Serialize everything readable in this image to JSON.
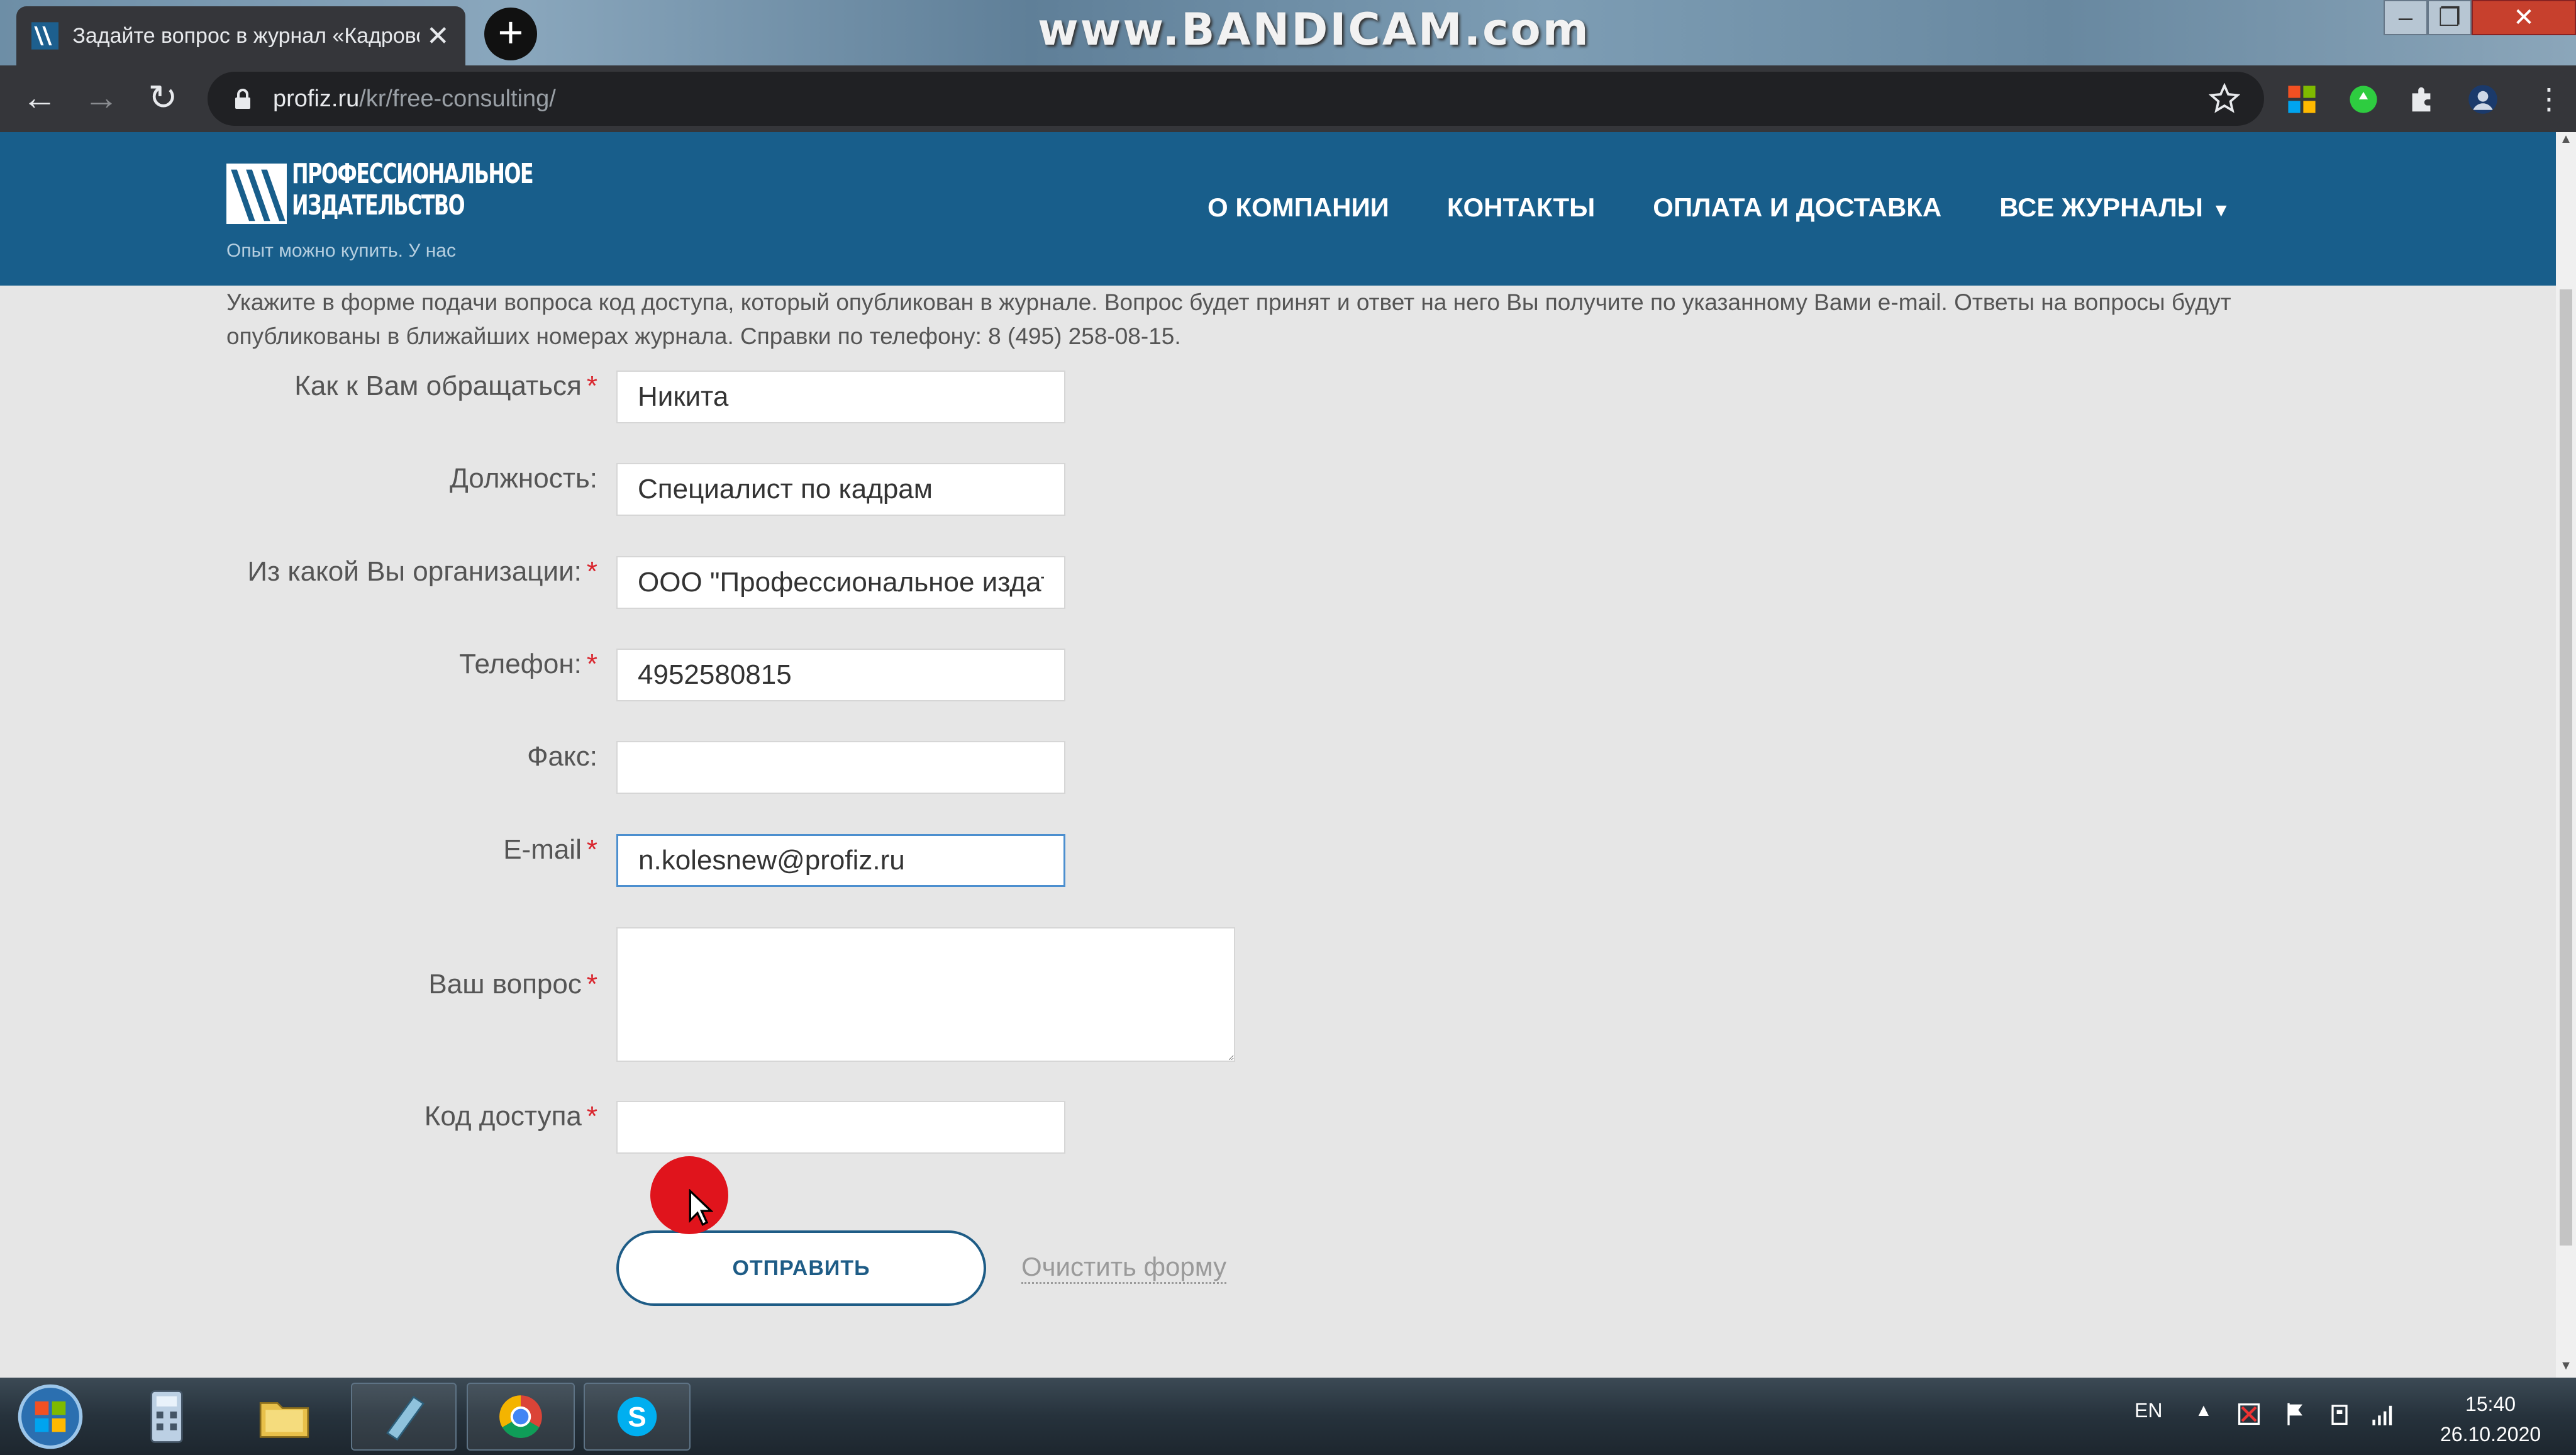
{
  "browser": {
    "tab_title": "Задайте вопрос в журнал «Кадровое дело»",
    "watermark": "www.BANDICAM.com",
    "url_host": "profiz.ru",
    "url_path": "/kr/free-consulting/"
  },
  "header": {
    "logo_line1": "ПРОФЕССИОНАЛЬНОЕ",
    "logo_line2": "ИЗДАТЕЛЬСТВО",
    "tagline": "Опыт можно купить. У нас",
    "nav": [
      "О КОМПАНИИ",
      "КОНТАКТЫ",
      "ОПЛАТА И ДОСТАВКА",
      "ВСЕ ЖУРНАЛЫ"
    ]
  },
  "intro_text": "Укажите в форме подачи вопроса код доступа, который опубликован в журнале. Вопрос будет принят и ответ на него Вы получите по указанному Вами e-mail. Ответы на вопросы будут опубликованы в ближайших номерах журнала. Справки по телефону: 8 (495) 258-08-15.",
  "form": {
    "name_label": "Как к Вам обращаться",
    "name_value": "Никита",
    "position_label": "Должность:",
    "position_value": "Специалист по кадрам",
    "org_label": "Из какой Вы организации:",
    "org_value": "ООО \"Профессиональное издательство\"",
    "phone_label": "Телефон:",
    "phone_value": "4952580815",
    "fax_label": "Факс:",
    "fax_value": "",
    "email_label": "E-mail",
    "email_value": "n.kolesnew@profiz.ru",
    "question_label": "Ваш вопрос",
    "question_value": "",
    "code_label": "Код доступа",
    "code_value": "",
    "required_mark": "*",
    "submit_label": "ОТПРАВИТЬ",
    "clear_label": "Очистить форму"
  },
  "taskbar": {
    "lang": "EN",
    "time": "15:40",
    "date": "26.10.2020"
  },
  "colors": {
    "header_bg": "#185e8b",
    "required": "#d9262e",
    "button_border": "#1e5c86"
  }
}
